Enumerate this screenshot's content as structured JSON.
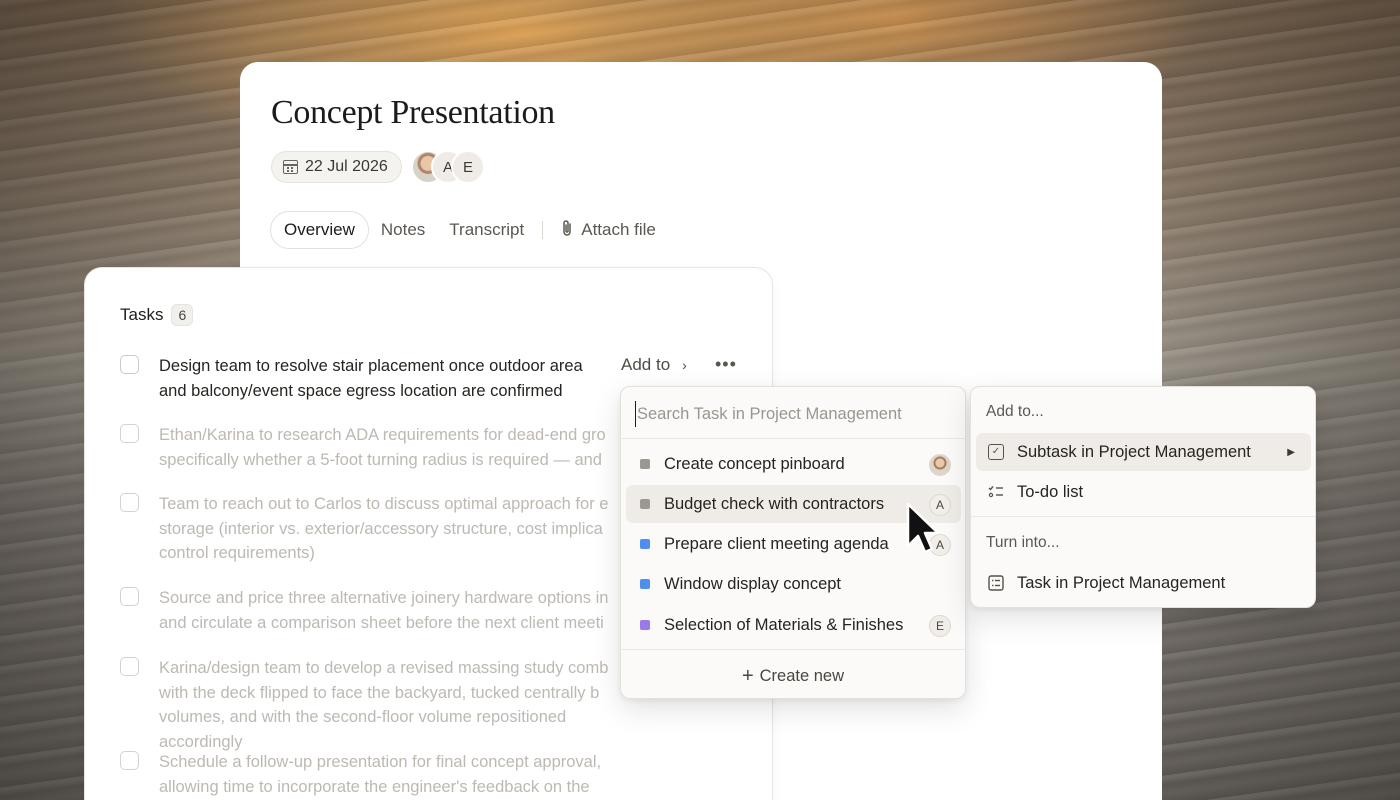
{
  "page": {
    "title": "Concept Presentation",
    "date": "22 Jul 2026",
    "avatars": [
      "A",
      "E"
    ]
  },
  "tabs": [
    {
      "label": "Overview",
      "active": true
    },
    {
      "label": "Notes"
    },
    {
      "label": "Transcript"
    },
    {
      "label": "Attach file"
    }
  ],
  "tasks": {
    "label": "Tasks",
    "count": "6",
    "items": [
      "Design team to resolve stair placement once outdoor area and balcony/event space egress location are confirmed",
      "Ethan/Karina to research ADA requirements for dead-end gro specifically whether a 5-foot turning radius is required — and",
      "Team to reach out to Carlos to discuss optimal approach for e storage (interior vs. exterior/accessory structure, cost implica control requirements)",
      "Source and price three alternative joinery hardware options in and circulate a comparison sheet before the next client meeti",
      "Karina/design team to develop a revised massing study comb with the deck flipped to face the backyard, tucked centrally b volumes, and with the second-floor volume repositioned accordingly",
      "Schedule a follow-up presentation for final concept approval, allowing time to incorporate the engineer's feedback on the terrace structure"
    ],
    "add_to_label": "Add to",
    "more_label": "•••"
  },
  "dropdown": {
    "search_placeholder": "Search Task in Project Management",
    "items": [
      {
        "label": "Create concept pinboard",
        "color": "#9b9892",
        "assignee": ""
      },
      {
        "label": "Budget check with contractors",
        "color": "#9b9892",
        "assignee": "A"
      },
      {
        "label": "Prepare client meeting agenda",
        "color": "#4f8ff0",
        "assignee": "A"
      },
      {
        "label": "Window display concept",
        "color": "#4f8ff0",
        "assignee": ""
      },
      {
        "label": "Selection of Materials & Finishes",
        "color": "#9a79e8",
        "assignee": "E"
      }
    ],
    "create_new": "Create new"
  },
  "submenu": {
    "add_to_label": "Add to...",
    "subtask_label": "Subtask in Project Management",
    "todo_label": "To-do list",
    "turn_into_label": "Turn into...",
    "task_label": "Task in Project Management"
  }
}
